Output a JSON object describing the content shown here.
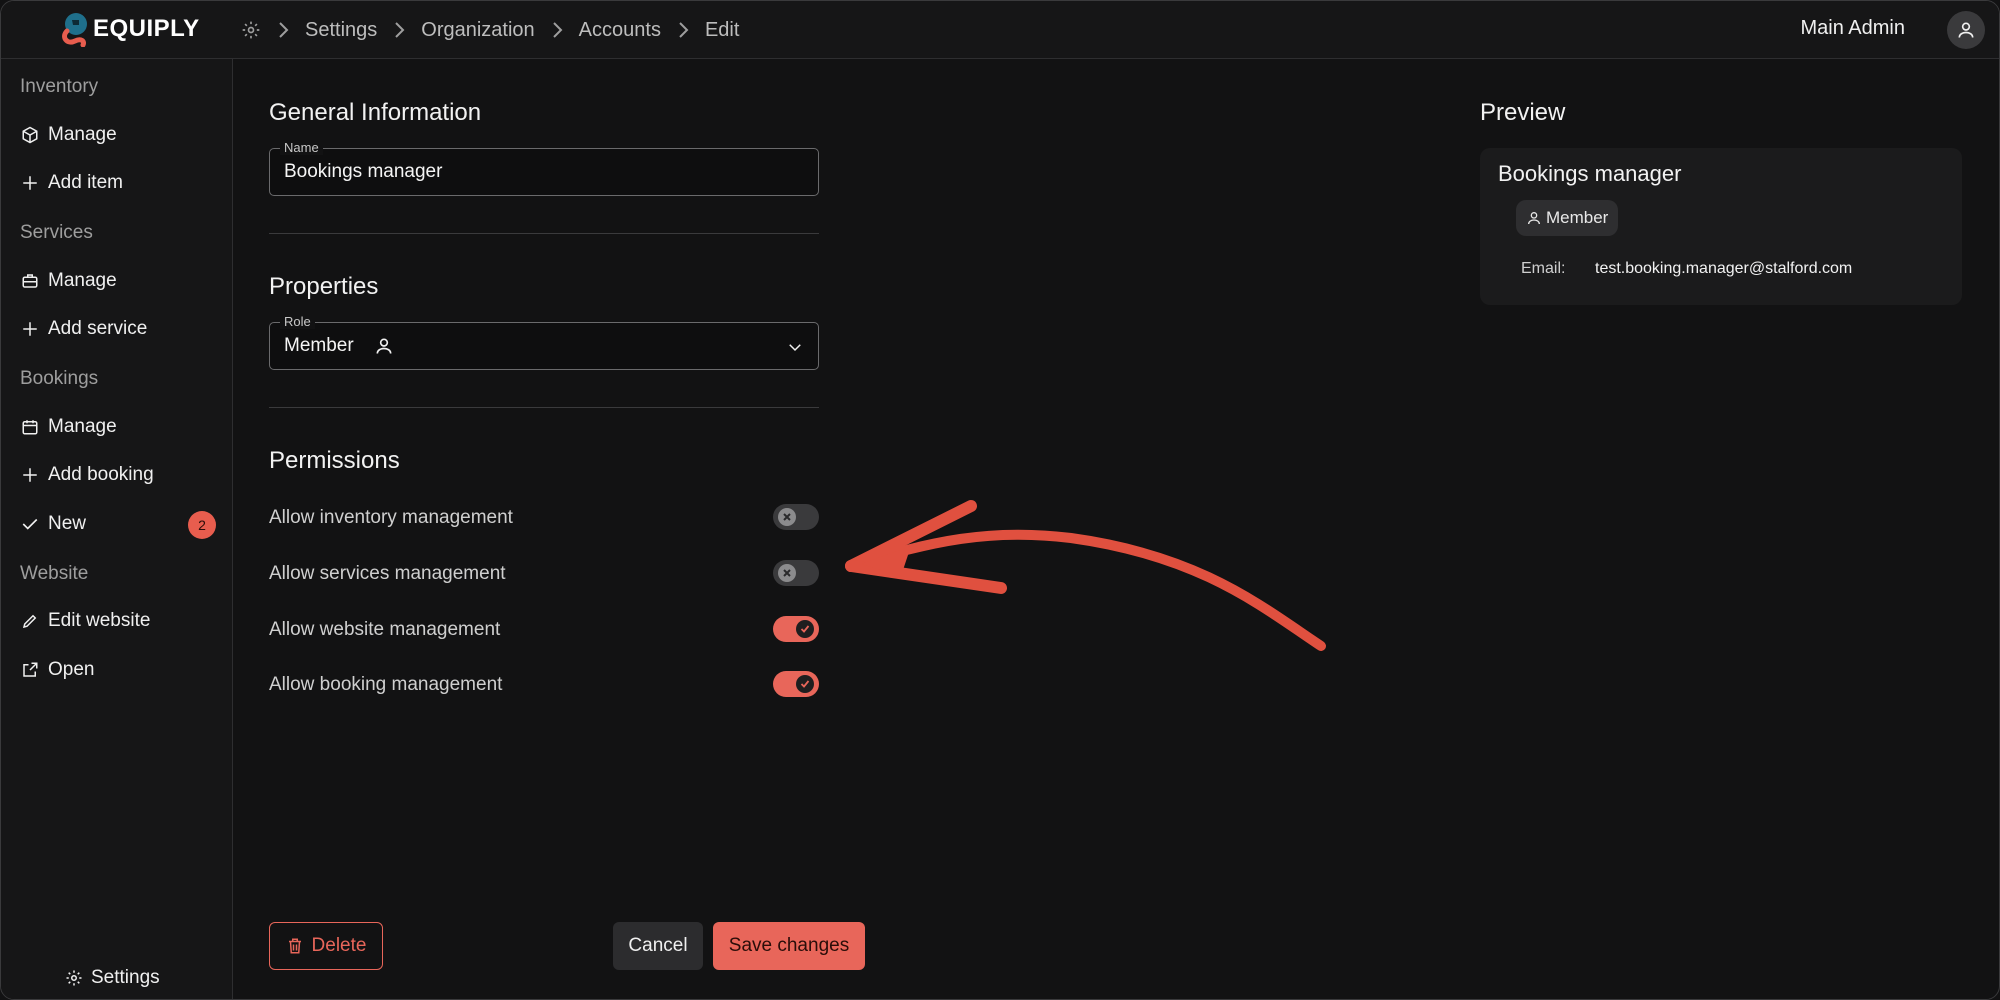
{
  "app": {
    "brand": "EQUIPLY"
  },
  "breadcrumb": [
    "Settings",
    "Organization",
    "Accounts",
    "Edit"
  ],
  "user": {
    "name": "Main Admin"
  },
  "sidebar": {
    "sections": [
      {
        "title": "Inventory",
        "items": [
          {
            "label": "Manage",
            "icon": "box-icon"
          },
          {
            "label": "Add item",
            "icon": "plus-icon"
          }
        ]
      },
      {
        "title": "Services",
        "items": [
          {
            "label": "Manage",
            "icon": "briefcase-icon"
          },
          {
            "label": "Add service",
            "icon": "plus-icon"
          }
        ]
      },
      {
        "title": "Bookings",
        "items": [
          {
            "label": "Manage",
            "icon": "calendar-icon"
          },
          {
            "label": "Add booking",
            "icon": "plus-icon"
          },
          {
            "label": "New",
            "icon": "check-icon",
            "badge": "2"
          }
        ]
      },
      {
        "title": "Website",
        "items": [
          {
            "label": "Edit website",
            "icon": "pencil-icon"
          },
          {
            "label": "Open",
            "icon": "external-link-icon"
          }
        ]
      }
    ],
    "settings_label": "Settings"
  },
  "general": {
    "title": "General Information",
    "name_label": "Name",
    "name_value": "Bookings manager"
  },
  "properties": {
    "title": "Properties",
    "role_label": "Role",
    "role_value": "Member"
  },
  "permissions": {
    "title": "Permissions",
    "items": [
      {
        "label": "Allow inventory management",
        "enabled": false
      },
      {
        "label": "Allow services management",
        "enabled": false
      },
      {
        "label": "Allow website management",
        "enabled": true
      },
      {
        "label": "Allow booking management",
        "enabled": true
      }
    ]
  },
  "actions": {
    "delete": "Delete",
    "cancel": "Cancel",
    "save": "Save changes"
  },
  "preview": {
    "title": "Preview",
    "name": "Bookings manager",
    "role": "Member",
    "email_label": "Email:",
    "email": "test.booking.manager@stalford.com"
  },
  "colors": {
    "accent": "#e8665a",
    "background": "#121213",
    "annotation_arrow": "#e0503f"
  }
}
